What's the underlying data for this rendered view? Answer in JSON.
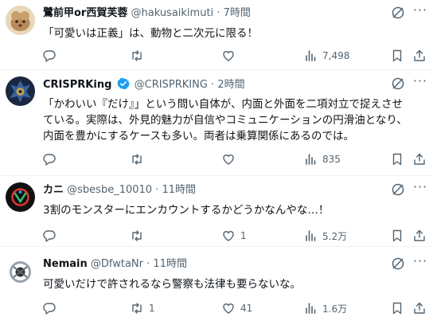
{
  "tweets": [
    {
      "name": "鷺前甲or西賀芙蓉",
      "handle": "@hakusaikimuti",
      "dot": "·",
      "time": "7時間",
      "verified": false,
      "lines": [
        "「可愛いは正義」は、動物と二次元に限る！"
      ],
      "stats": {
        "reply": "",
        "retweet": "",
        "like": "",
        "views": "7,498"
      }
    },
    {
      "name": "CRISPRKing",
      "handle": "@CRISPRKING",
      "dot": "·",
      "time": "2時間",
      "verified": true,
      "lines": [
        "「かわいい『だけ』」という問い自体が、内面と外面を二項対立で捉えさせ",
        "ている。実際は、外見的魅力が自信やコミュニケーションの円滑油となり、",
        "内面を豊かにするケースも多い。両者は乗算関係にあるのでは。"
      ],
      "stats": {
        "reply": "",
        "retweet": "",
        "like": "",
        "views": "835"
      }
    },
    {
      "name": "カニ",
      "handle": "@sbesbe_10010",
      "dot": "·",
      "time": "11時間",
      "verified": false,
      "lines": [
        "3割のモンスターにエンカウントするかどうかなんやな…！"
      ],
      "stats": {
        "reply": "",
        "retweet": "",
        "like": "1",
        "views": "5.2万"
      }
    },
    {
      "name": "Nemain",
      "handle": "@DfwtaNr",
      "dot": "·",
      "time": "11時間",
      "verified": false,
      "lines": [
        "可愛いだけで許されるなら警察も法律も要らないな。"
      ],
      "stats": {
        "reply": "",
        "retweet": "1",
        "like": "41",
        "views": "1.6万"
      }
    }
  ],
  "colors": {
    "text": "#0f1419",
    "muted": "#536471",
    "verified": "#1d9bf0",
    "divider": "#eff3f4"
  },
  "icons": [
    "reply-icon",
    "retweet-icon",
    "like-icon",
    "views-icon",
    "bookmark-icon",
    "share-icon",
    "grok-icon",
    "more-icon",
    "verified-badge-icon"
  ]
}
